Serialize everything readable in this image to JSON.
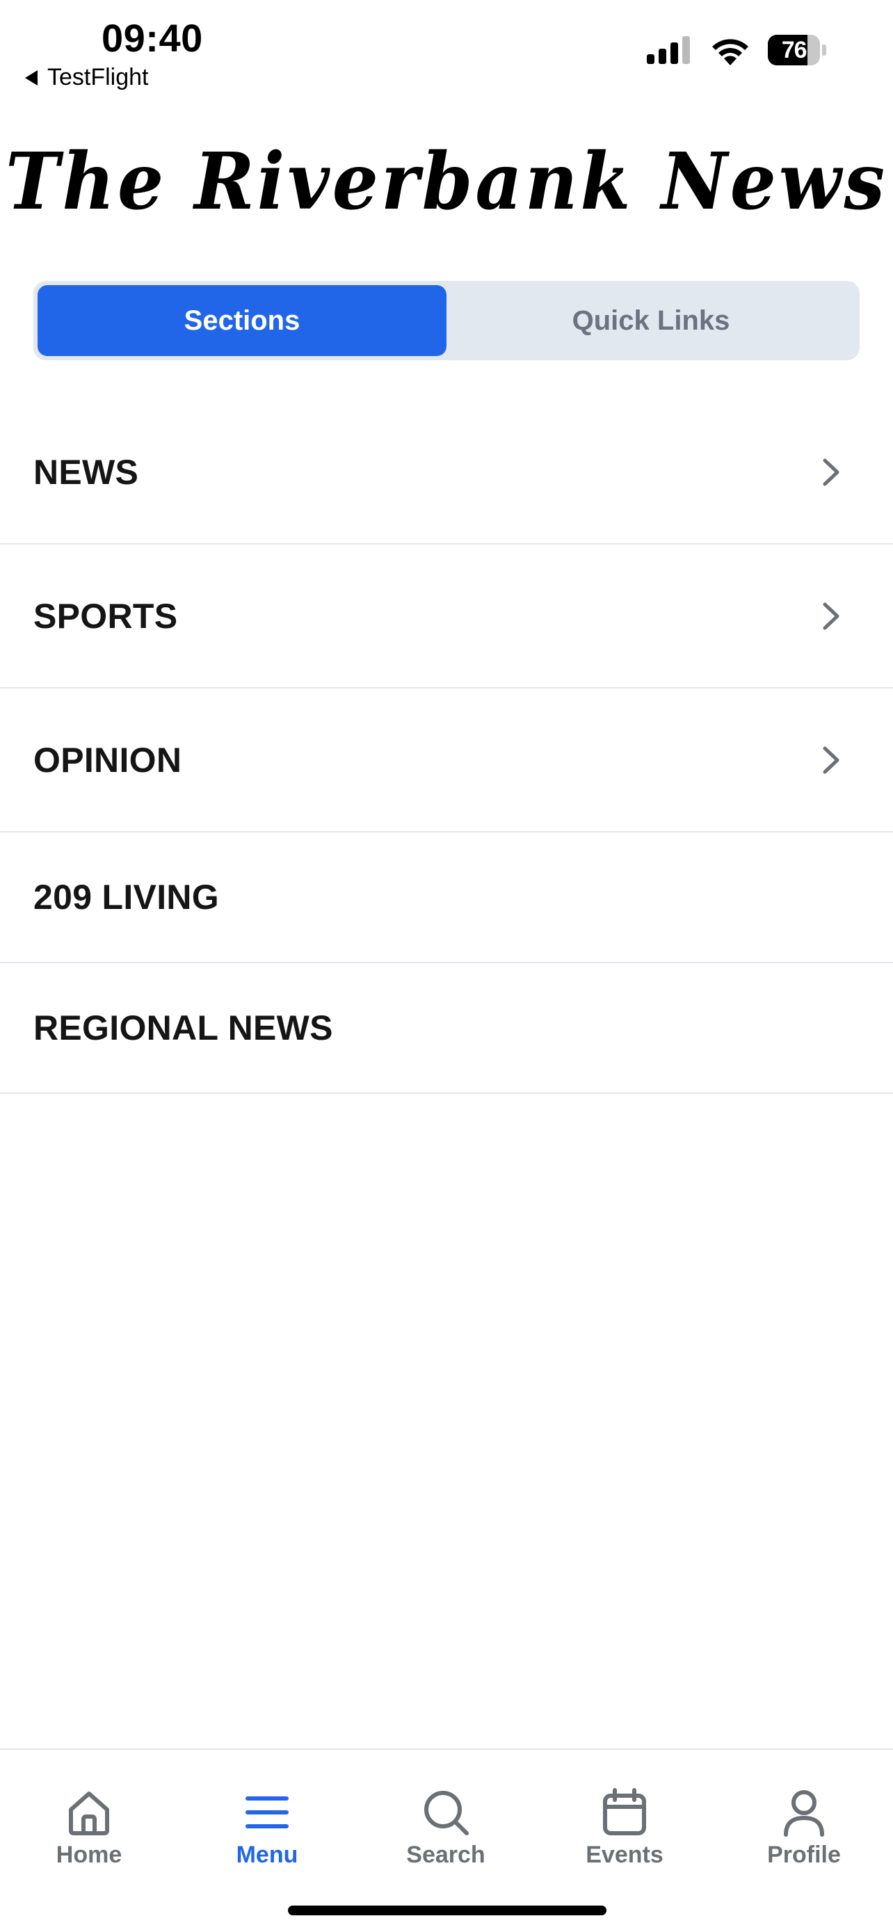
{
  "status_bar": {
    "time": "09:40",
    "back_app": "TestFlight",
    "battery_level": "76",
    "battery_fraction": 0.76
  },
  "masthead": {
    "title": "The Riverbank News"
  },
  "segmented_control": {
    "active_label": "Sections",
    "inactive_label": "Quick Links"
  },
  "sections": [
    {
      "label": "NEWS",
      "has_chevron": true
    },
    {
      "label": "SPORTS",
      "has_chevron": true
    },
    {
      "label": "OPINION",
      "has_chevron": true
    },
    {
      "label": "209 LIVING",
      "has_chevron": false
    },
    {
      "label": "REGIONAL NEWS",
      "has_chevron": false
    }
  ],
  "tab_bar": {
    "items": [
      {
        "label": "Home",
        "icon": "home-icon",
        "active": false
      },
      {
        "label": "Menu",
        "icon": "menu-icon",
        "active": true
      },
      {
        "label": "Search",
        "icon": "search-icon",
        "active": false
      },
      {
        "label": "Events",
        "icon": "calendar-icon",
        "active": false
      },
      {
        "label": "Profile",
        "icon": "profile-icon",
        "active": false
      }
    ]
  },
  "colors": {
    "accent": "#2166e8",
    "segmented_bg": "#e2e8f0",
    "inactive_tab": "#6b6f76",
    "divider": "#e3e6ee"
  }
}
